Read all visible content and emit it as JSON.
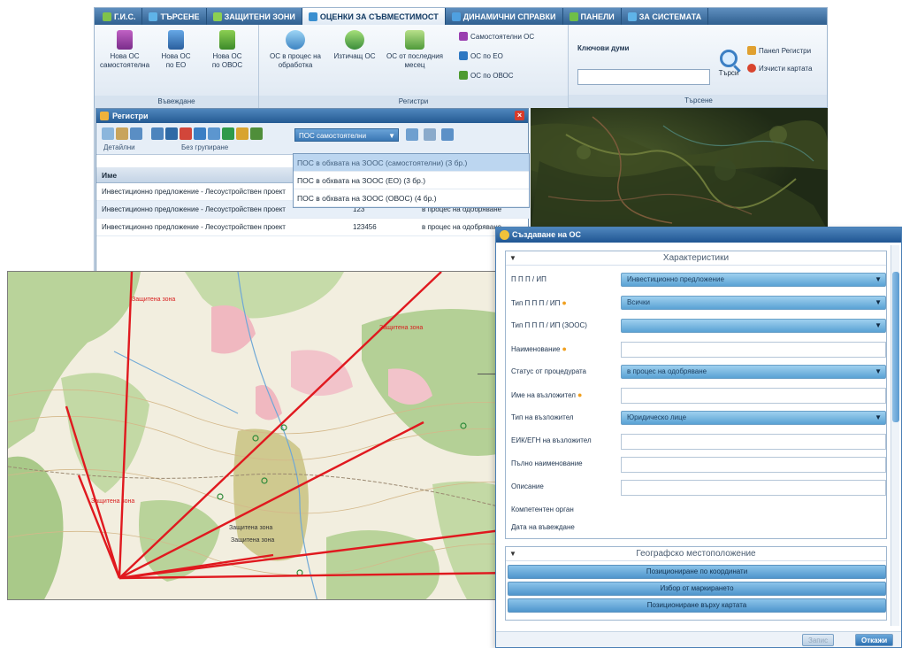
{
  "tabs": [
    {
      "label": "Г.И.С.",
      "color": "#7fc24a"
    },
    {
      "label": "ТЪРСЕНЕ",
      "color": "#5fb3e8"
    },
    {
      "label": "ЗАЩИТЕНИ ЗОНИ",
      "color": "#8ccf52"
    },
    {
      "label": "ОЦЕНКИ ЗА СЪВМЕСТИМОСТ",
      "color": "#3a8fd0"
    },
    {
      "label": "ДИНАМИЧНИ СПРАВКИ",
      "color": "#4fa0e0"
    },
    {
      "label": "ПАНЕЛИ",
      "color": "#6fbf48"
    },
    {
      "label": "ЗА СИСТЕМАТА",
      "color": "#5fb3e8"
    }
  ],
  "ribbon": {
    "input_group": {
      "label": "Въвеждане",
      "buttons": [
        {
          "line1": "Нова ОС",
          "line2": "самостоятелна"
        },
        {
          "line1": "Нова ОС",
          "line2": "по ЕО"
        },
        {
          "line1": "Нова ОС",
          "line2": "по ОВОС"
        }
      ]
    },
    "registers_group": {
      "label": "Регистри",
      "buttons": [
        {
          "line1": "ОС в процес на",
          "line2": "обработка"
        },
        {
          "line1": "Изтичащ ОС",
          "line2": ""
        },
        {
          "line1": "ОС от последния",
          "line2": "месец"
        }
      ],
      "small_items": [
        "Самостоятелни ОС",
        "ОС по ЕО",
        "ОС по ОВОС"
      ]
    },
    "search_group": {
      "label": "Търсене",
      "keywords_label": "Ключови думи",
      "search_button": "Търси",
      "links": [
        "Панел Регистри",
        "Изчисти картата"
      ]
    }
  },
  "register_panel": {
    "title": "Регистри",
    "toolbar_labels": [
      "Детайлни",
      "Без групиране"
    ],
    "select_value": "ПОС самостоятелни",
    "dropdown": [
      "ПОС в обхвата на ЗООС (самостоятелни) (3 бр.)",
      "ПОС в обхвата на ЗООС (ЕО) (3 бр.)",
      "ПОС в обхвата на ЗООС (ОВОС) (4 бр.)"
    ],
    "column_header": "Име",
    "rows": [
      {
        "name": "Инвестиционно предложение - Лесоустройствен проект",
        "num": "",
        "status": ""
      },
      {
        "name": "Инвестиционно предложение - Лесоустройствен проект",
        "num": "123",
        "status": "в процес на одобряване"
      },
      {
        "name": "Инвестиционно предложение - Лесоустройствен проект",
        "num": "123456",
        "status": "в процес на одобряване"
      }
    ]
  },
  "map": {
    "labels": [
      "Защитена зона",
      "Защитена зона",
      "Защитена зона",
      "Защитена зона",
      "Защитена зона"
    ]
  },
  "dialog": {
    "title": "Създаване на ОС",
    "characteristics": {
      "header": "Характеристики",
      "fields": [
        {
          "label": "П П П / ИП",
          "required": false,
          "type": "select",
          "value": "Инвестиционно предложение"
        },
        {
          "label": "Тип П П П / ИП",
          "required": true,
          "type": "select",
          "value": "Всички"
        },
        {
          "label": "Тип П П П / ИП (ЗООС)",
          "required": false,
          "type": "select",
          "value": ""
        },
        {
          "label": "Наименование",
          "required": true,
          "type": "input",
          "value": ""
        },
        {
          "label": "Статус от процедурата",
          "required": false,
          "type": "select",
          "value": "в процес на одобряване"
        },
        {
          "label": "Име на възложител",
          "required": true,
          "type": "input",
          "value": ""
        },
        {
          "label": "Тип на възложител",
          "required": false,
          "type": "select",
          "value": "Юридическо лице"
        },
        {
          "label": "ЕИК/ЕГН на възложител",
          "required": false,
          "type": "input",
          "value": ""
        },
        {
          "label": "Пълно наименование",
          "required": false,
          "type": "input",
          "value": ""
        },
        {
          "label": "Описание",
          "required": false,
          "type": "input",
          "value": ""
        },
        {
          "label": "Компетентен орган",
          "required": false,
          "type": "none",
          "value": ""
        },
        {
          "label": "Дата на въвеждане",
          "required": false,
          "type": "none",
          "value": ""
        }
      ]
    },
    "geo": {
      "header": "Географско местоположение",
      "buttons": [
        "Позициониране по координати",
        "Избор от маркирането",
        "Позициониране върху картата"
      ]
    },
    "footer": {
      "save": "Запис",
      "close": "Откажи"
    }
  }
}
